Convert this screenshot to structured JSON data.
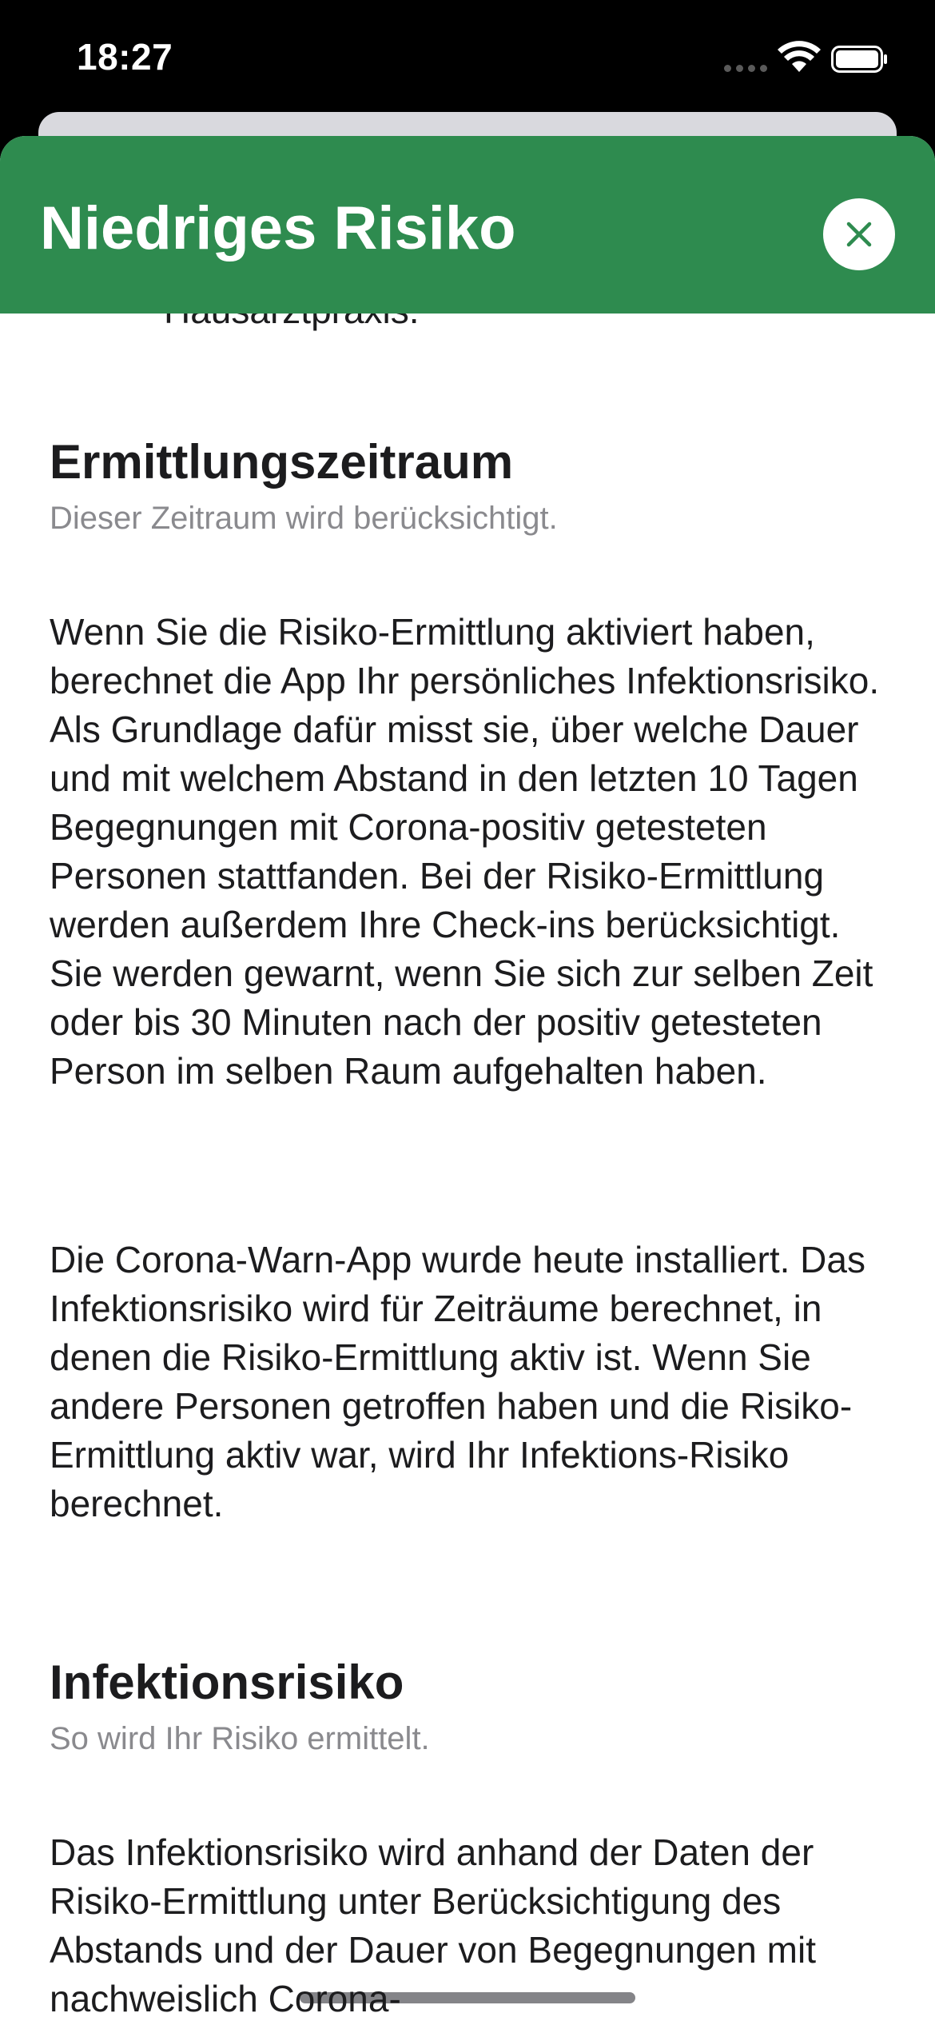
{
  "status_bar": {
    "time": "18:27"
  },
  "header": {
    "title": "Niedriges Risiko",
    "close_icon": "close-x-icon",
    "color": "#2e8b4f"
  },
  "content": {
    "clipped_text": "Hausarztpraxis.",
    "sections": [
      {
        "title": "Ermittlungszeitraum",
        "subtitle": "Dieser Zeitraum wird berücksichtigt.",
        "paragraphs": [
          "Wenn Sie die Risiko-Ermittlung aktiviert haben, berechnet die App Ihr persönliches Infektionsrisiko. Als Grundlage dafür misst sie, über welche Dauer und mit welchem Abstand in den letzten 10 Tagen Begegnungen mit Corona-positiv getesteten Personen stattfanden. Bei der Risiko-Ermittlung werden außerdem Ihre Check-ins berücksichtigt. Sie werden gewarnt, wenn Sie sich zur selben Zeit oder bis 30 Minuten nach der positiv getesteten Person im selben Raum aufgehalten haben.",
          "Die Corona-Warn-App wurde heute installiert. Das Infektionsrisiko wird für Zeiträume berechnet, in denen die Risiko-Ermittlung aktiv ist. Wenn Sie andere Personen getroffen haben und die Risiko-Ermittlung aktiv war, wird Ihr Infektions-Risiko berechnet."
        ]
      },
      {
        "title": "Infektionsrisiko",
        "subtitle": "So wird Ihr Risiko ermittelt.",
        "paragraphs": [
          "Das Infektionsrisiko wird anhand der Daten der Risiko-Ermittlung unter Berücksichtigung des Abstands und der Dauer von Begegnungen mit nachweislich Corona-"
        ]
      }
    ]
  }
}
